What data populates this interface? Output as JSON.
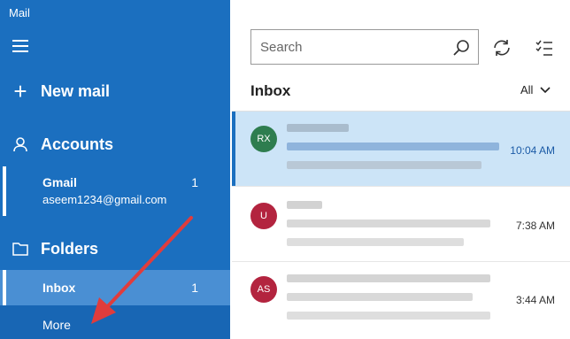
{
  "app": {
    "title": "Mail"
  },
  "sidebar": {
    "new_mail_label": "New mail",
    "accounts_label": "Accounts",
    "account": {
      "name": "Gmail",
      "email": "aseem1234@gmail.com",
      "count": "1"
    },
    "folders_label": "Folders",
    "inbox": {
      "label": "Inbox",
      "count": "1"
    },
    "more_label": "More"
  },
  "search": {
    "placeholder": "Search"
  },
  "list": {
    "title": "Inbox",
    "filter_label": "All",
    "messages": [
      {
        "initials": "RX",
        "avatar_color": "#2e7d4f",
        "time": "10:04 AM"
      },
      {
        "initials": "U",
        "avatar_color": "#b3243f",
        "time": "7:38 AM"
      },
      {
        "initials": "AS",
        "avatar_color": "#b3243f",
        "time": "3:44 AM"
      }
    ]
  },
  "colors": {
    "sidebar": "#1b6fbf",
    "accent": "#1b6fbf",
    "selected_row": "#cce4f7",
    "arrow": "#e03c3c"
  }
}
